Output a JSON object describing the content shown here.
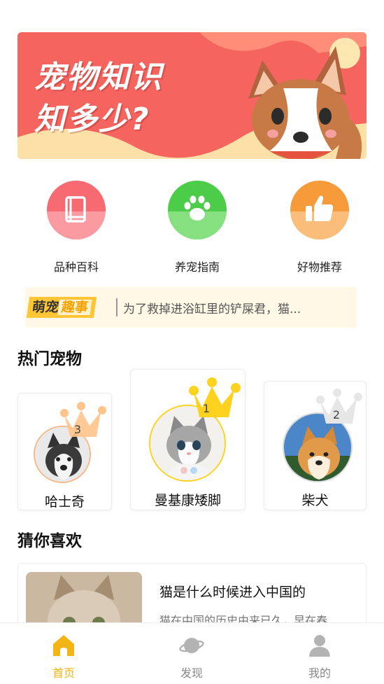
{
  "banner": {
    "line1": "宠物知识",
    "line2": "知多少?"
  },
  "categories": [
    {
      "label": "品种百科",
      "icon": "book-icon",
      "color": "#f76a72"
    },
    {
      "label": "养宠指南",
      "icon": "paw-icon",
      "color": "#4ccc48"
    },
    {
      "label": "好物推荐",
      "icon": "thumbs-up-icon",
      "color": "#f79a3a"
    }
  ],
  "notice": {
    "tag_part1": "萌宠",
    "tag_part2": "趣事",
    "text": "为了救掉进浴缸里的铲屎君，猫..."
  },
  "hot_pets": {
    "title": "热门宠物",
    "items": [
      {
        "rank": "3",
        "name": "哈士奇"
      },
      {
        "rank": "1",
        "name": "曼基康矮脚"
      },
      {
        "rank": "2",
        "name": "柴犬"
      }
    ]
  },
  "guess": {
    "title": "猜你喜欢",
    "article": {
      "title": "猫是什么时候进入中国的",
      "desc": "猫在中国的历史由来已久，早在春"
    }
  },
  "tabbar": {
    "items": [
      {
        "label": "首页",
        "icon": "home-icon",
        "active": true
      },
      {
        "label": "发现",
        "icon": "planet-icon",
        "active": false
      },
      {
        "label": "我的",
        "icon": "user-icon",
        "active": false
      }
    ]
  },
  "colors": {
    "accent": "#f3b513",
    "banner_red": "#f5645e",
    "gold_crown": "#ffd21f",
    "silver_crown": "#e6e6e6",
    "bronze_crown": "#ffc48a"
  }
}
